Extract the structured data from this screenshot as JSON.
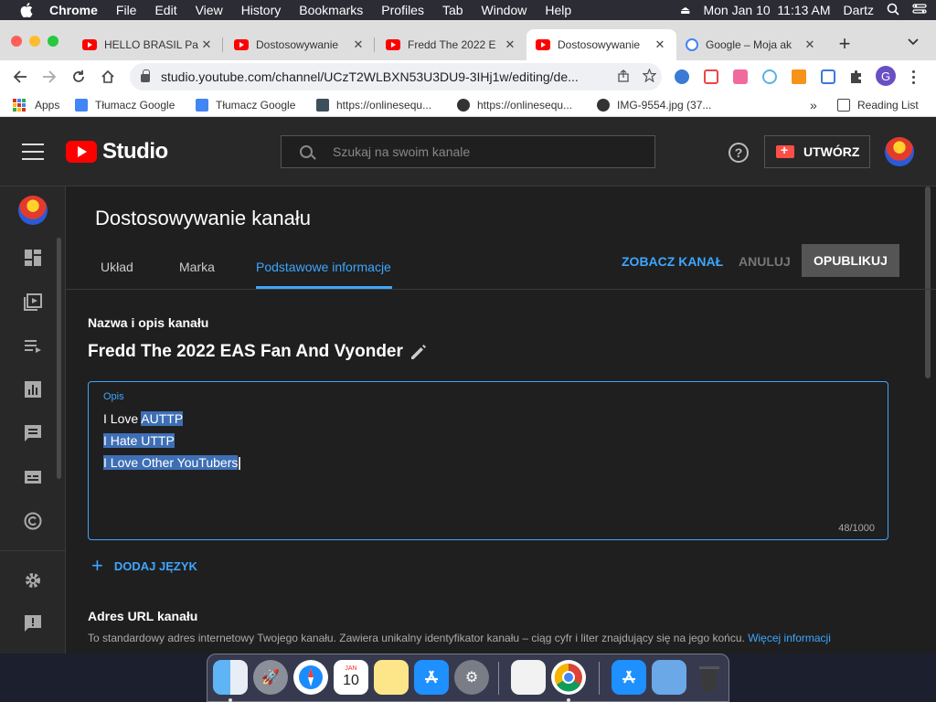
{
  "menubar": {
    "app_name": "Chrome",
    "items": [
      "File",
      "Edit",
      "View",
      "History",
      "Bookmarks",
      "Profiles",
      "Tab",
      "Window",
      "Help"
    ],
    "datetime": "Mon Jan 10  11:13 AM",
    "user": "Dartz"
  },
  "tabs": [
    {
      "title": "HELLO BRASIL Pa",
      "favicon": "youtube-icon",
      "active": false
    },
    {
      "title": "Dostosowywanie",
      "favicon": "youtube-icon",
      "active": false
    },
    {
      "title": "Fredd The 2022 E",
      "favicon": "youtube-icon",
      "active": false
    },
    {
      "title": "Dostosowywanie",
      "favicon": "youtube-icon",
      "active": true
    },
    {
      "title": "Google – Moja ak",
      "favicon": "google-icon",
      "active": false
    }
  ],
  "toolbar": {
    "url": "studio.youtube.com/channel/UCzT2WLBXN53U3DU9-3IHj1w/editing/de...",
    "profile_initial": "G"
  },
  "bookmarks": {
    "apps_label": "Apps",
    "items": [
      {
        "label": "Tłumacz Google",
        "icon": "translate-icon"
      },
      {
        "label": "Tłumacz Google",
        "icon": "translate-icon"
      },
      {
        "label": "https://onlinesequ...",
        "icon": "sequencer-icon"
      },
      {
        "label": "https://onlinesequ...",
        "icon": "globe-icon"
      },
      {
        "label": "IMG-9554.jpg (37...",
        "icon": "globe-icon"
      }
    ],
    "overflow": "»",
    "reading_list": "Reading List"
  },
  "studio": {
    "logo_text": "Studio",
    "search_placeholder": "Szukaj na swoim kanale",
    "create_label": "UTWÓRZ",
    "page_title": "Dostosowywanie kanału",
    "tabs": [
      "Układ",
      "Marka",
      "Podstawowe informacje"
    ],
    "active_tab": "Podstawowe informacje",
    "view_channel": "ZOBACZ KANAŁ",
    "cancel": "ANULUJ",
    "publish": "OPUBLIKUJ",
    "section_title": "Nazwa i opis kanału",
    "channel_name": "Fredd The 2022 EAS Fan And Vyonder",
    "description_label": "Opis",
    "description_lines": [
      {
        "plain": "I Love ",
        "selected": "AUTTP"
      },
      {
        "plain": "",
        "selected": "I Hate UTTP"
      },
      {
        "plain": "",
        "selected": "I Love Other YouTubers"
      }
    ],
    "char_count": "48/1000",
    "add_language": "DODAJ JĘZYK",
    "url_title": "Adres URL kanału",
    "url_desc": "To standardowy adres internetowy Twojego kanału. Zawiera unikalny identyfikator kanału – ciąg cyfr i liter znajdujący się na jego końcu.",
    "url_more": "Więcej informacji"
  },
  "colors": {
    "accent_blue": "#3ea6ff",
    "youtube_red": "#ff0000",
    "selection": "#3e6fb5"
  }
}
